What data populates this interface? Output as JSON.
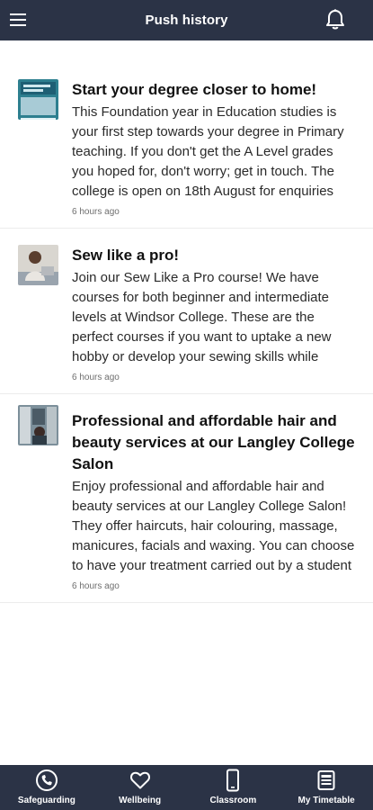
{
  "header": {
    "title": "Push history"
  },
  "icons": {
    "menu": "hamburger-menu-icon",
    "bell": "bell-icon"
  },
  "notifications": [
    {
      "title": "Start your degree closer to home!",
      "body": "This Foundation year in Education studies is your first step towards your degree in Primary teaching. If you don't get the A Level grades you hoped for, don't worry; get in touch. The college is open on 18th August for enquiries and enrolment. Application",
      "time": "6 hours ago"
    },
    {
      "title": "Sew like a pro!",
      "body": "Join our Sew Like a Pro course! We have courses for both beginner and intermediate levels at Windsor College. These are the perfect courses if you want to uptake a new hobby or develop your sewing skills while making friends at the same time. Follow the b",
      "time": "6 hours ago"
    },
    {
      "title": "Professional and affordable hair and beauty services at our Langley College Salon",
      "body": "Enjoy professional and affordable hair and beauty services at our Langley College Salon! They offer haircuts, hair colouring, massage, manicures, facials and waxing. You can choose to have your treatment carried out by a student under the supervision of f",
      "time": "6 hours ago"
    }
  ],
  "tabs": [
    {
      "label": "Safeguarding",
      "icon": "phone-icon"
    },
    {
      "label": "Wellbeing",
      "icon": "heart-icon"
    },
    {
      "label": "Classroom",
      "icon": "mobile-device-icon"
    },
    {
      "label": "My Timetable",
      "icon": "timetable-icon"
    }
  ],
  "colors": {
    "bar": "#2b3346",
    "text": "#111111",
    "muted": "#6f6f6f"
  }
}
